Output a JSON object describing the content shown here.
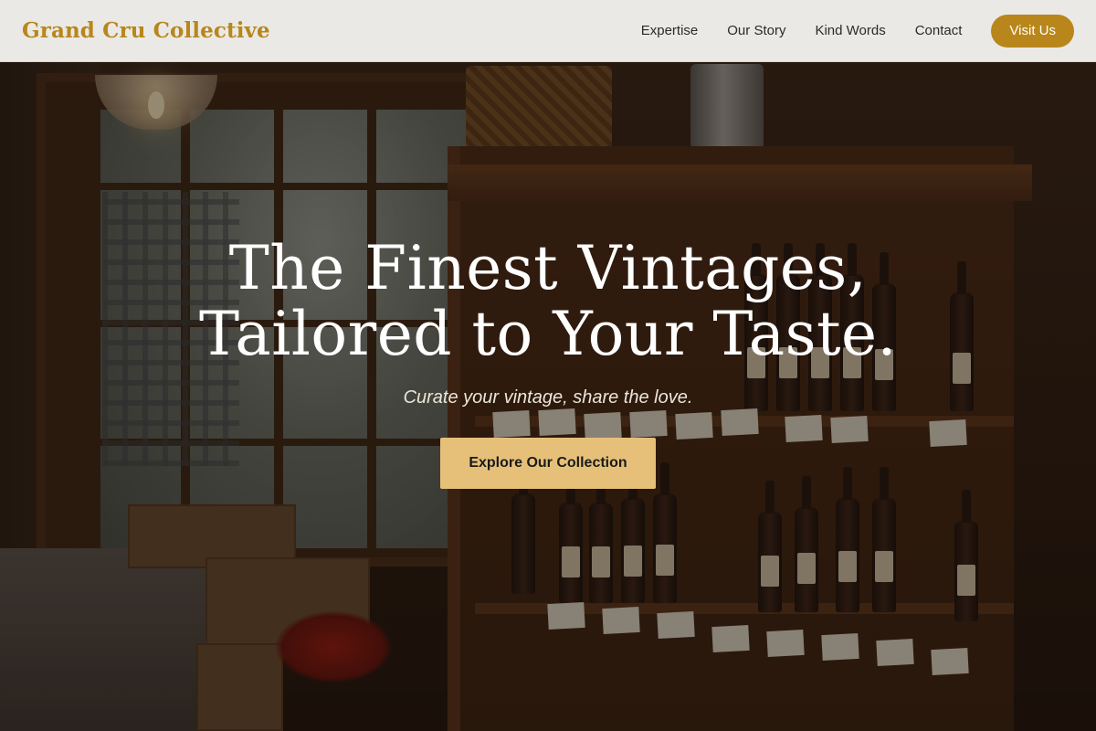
{
  "navbar": {
    "brand": "Grand Cru Collective",
    "links": [
      {
        "label": "Expertise"
      },
      {
        "label": "Our Story"
      },
      {
        "label": "Kind Words"
      },
      {
        "label": "Contact"
      }
    ],
    "cta_label": "Visit Us"
  },
  "hero": {
    "title_line1": "The Finest Vintages,",
    "title_line2": "Tailored to Your Taste.",
    "subtitle": "Curate your vintage, share the love.",
    "cta_label": "Explore Our Collection"
  },
  "colors": {
    "brand_gold": "#b8861b",
    "cta_gold": "#e6c079",
    "nav_bg": "#f2f1ef",
    "title_text": "#ffffff"
  }
}
